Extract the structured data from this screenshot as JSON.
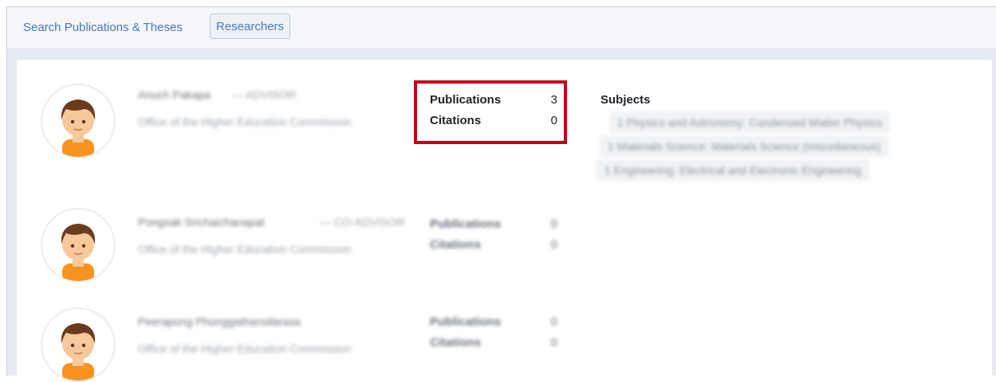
{
  "nav": {
    "search_link": "Search Publications & Theses",
    "researchers_tab": "Researchers"
  },
  "researchers": [
    {
      "name": "Anuch Pakapa",
      "role": "— ADVISOR",
      "org": "Office of the Higher Education Commission",
      "stats": {
        "publications_label": "Publications",
        "publications": "3",
        "citations_label": "Citations",
        "citations": "0"
      },
      "subjects_title": "Subjects",
      "subjects": [
        "1 Physics and Astronomy: Condensed Matter Physics",
        "1 Materials Science: Materials Science (miscellaneous)",
        "1 Engineering: Electrical and Electronic Engineering"
      ]
    },
    {
      "name": "Pongsak Srichaichanapat",
      "role": "— CO-ADVISOR",
      "org": "Office of the Higher Education Commission",
      "stats": {
        "publications_label": "Publications",
        "publications": "0",
        "citations_label": "Citations",
        "citations": "0"
      }
    },
    {
      "name": "Peerapong Phonggathansilarasa",
      "role": "",
      "org": "Office of the Higher Education Commission",
      "stats": {
        "publications_label": "Publications",
        "publications": "0",
        "citations_label": "Citations",
        "citations": "0"
      }
    }
  ],
  "colors": {
    "highlight_border": "#c0001a",
    "link": "#4a78b5"
  },
  "icons": {
    "avatar": "avatar-icon"
  }
}
